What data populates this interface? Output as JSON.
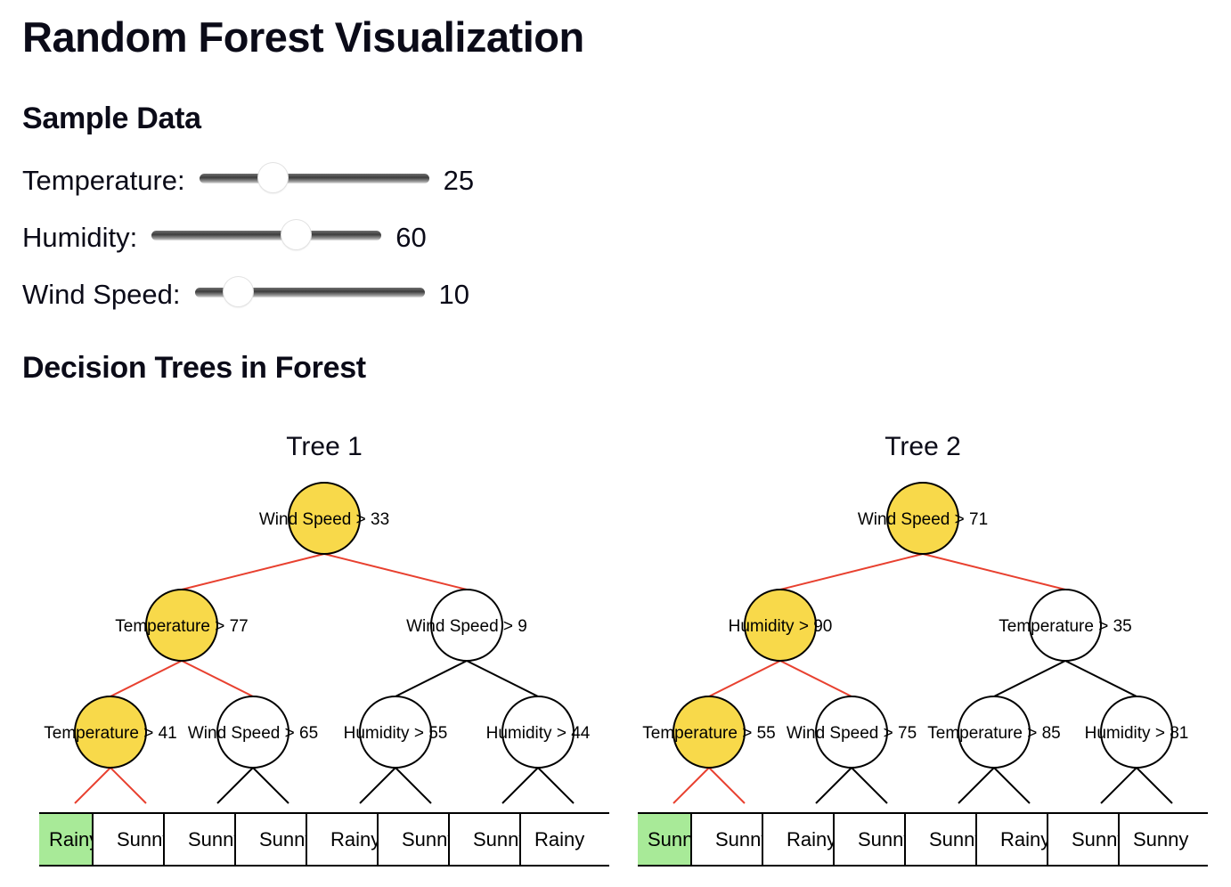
{
  "page": {
    "title": "Random Forest Visualization",
    "sample_heading": "Sample Data",
    "trees_heading": "Decision Trees in Forest"
  },
  "controls": [
    {
      "label": "Temperature:",
      "value": 25,
      "display": "25",
      "min": 0,
      "max": 100
    },
    {
      "label": "Humidity:",
      "value": 60,
      "display": "60",
      "min": 0,
      "max": 100
    },
    {
      "label": "Wind Speed:",
      "value": 10,
      "display": "10",
      "min": 0,
      "max": 100
    }
  ],
  "colors": {
    "active_node": "#F8D94A",
    "active_edge": "#E8402F",
    "inactive_edge": "#000000",
    "predicted_leaf": "#A8EA98",
    "node_stroke": "#000000"
  },
  "trees": [
    {
      "title": "Tree 1",
      "nodes": [
        {
          "label": "Wind Speed > 33",
          "active": true
        },
        {
          "label": "Temperature > 77",
          "active": true
        },
        {
          "label": "Wind Speed > 9",
          "active": false
        },
        {
          "label": "Temperature > 41",
          "active": true
        },
        {
          "label": "Wind Speed > 65",
          "active": false
        },
        {
          "label": "Humidity > 55",
          "active": false
        },
        {
          "label": "Humidity > 44",
          "active": false
        }
      ],
      "active_edges": [
        [
          0,
          1
        ],
        [
          0,
          2
        ],
        [
          1,
          3
        ],
        [
          1,
          4
        ],
        [
          3,
          "L0"
        ],
        [
          3,
          "L1"
        ]
      ],
      "leaves": [
        {
          "label": "Rainy",
          "predicted": true
        },
        {
          "label": "Sunny",
          "predicted": false
        },
        {
          "label": "Sunny",
          "predicted": false
        },
        {
          "label": "Sunny",
          "predicted": false
        },
        {
          "label": "Rainy",
          "predicted": false
        },
        {
          "label": "Sunny",
          "predicted": false
        },
        {
          "label": "Sunny",
          "predicted": false
        },
        {
          "label": "Rainy",
          "predicted": false
        }
      ]
    },
    {
      "title": "Tree 2",
      "nodes": [
        {
          "label": "Wind Speed > 71",
          "active": true
        },
        {
          "label": "Humidity > 90",
          "active": true
        },
        {
          "label": "Temperature > 35",
          "active": false
        },
        {
          "label": "Temperature > 55",
          "active": true
        },
        {
          "label": "Wind Speed > 75",
          "active": false
        },
        {
          "label": "Temperature > 85",
          "active": false
        },
        {
          "label": "Humidity > 81",
          "active": false
        }
      ],
      "active_edges": [
        [
          0,
          1
        ],
        [
          0,
          2
        ],
        [
          1,
          3
        ],
        [
          1,
          4
        ],
        [
          3,
          "L0"
        ],
        [
          3,
          "L1"
        ]
      ],
      "leaves": [
        {
          "label": "Sunny",
          "predicted": true
        },
        {
          "label": "Sunny",
          "predicted": false
        },
        {
          "label": "Rainy",
          "predicted": false
        },
        {
          "label": "Sunny",
          "predicted": false
        },
        {
          "label": "Sunny",
          "predicted": false
        },
        {
          "label": "Rainy",
          "predicted": false
        },
        {
          "label": "Sunny",
          "predicted": false
        },
        {
          "label": "Sunny",
          "predicted": false
        }
      ]
    }
  ]
}
